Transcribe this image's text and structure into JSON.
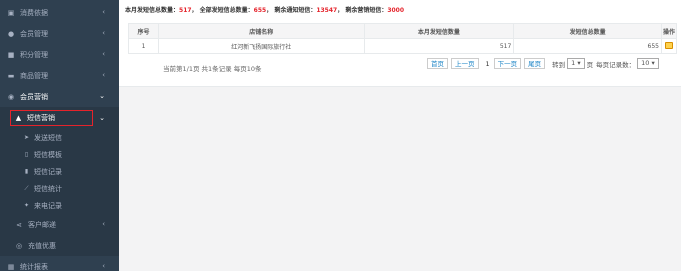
{
  "sidebar": {
    "items": [
      {
        "icon": "list-alt-icon",
        "label": "消费依据",
        "chev": "‹"
      },
      {
        "icon": "user-icon",
        "label": "会员管理",
        "chev": "‹"
      },
      {
        "icon": "gift-icon",
        "label": "积分管理",
        "chev": "‹"
      },
      {
        "icon": "cart-icon",
        "label": "商品管理",
        "chev": "‹"
      },
      {
        "icon": "globe-icon",
        "label": "会员营销",
        "chev": "⌄"
      }
    ],
    "active_sub": {
      "icon": "bullhorn-icon",
      "label": "短信营销",
      "chev": "⌄"
    },
    "subsub": [
      {
        "icon": "send-icon",
        "label": "发送短信"
      },
      {
        "icon": "file-icon",
        "label": "短信模板"
      },
      {
        "icon": "bar-chart-icon",
        "label": "短信记录"
      },
      {
        "icon": "line-chart-icon",
        "label": "短信统计"
      },
      {
        "icon": "twitter-icon",
        "label": "来电记录"
      }
    ],
    "after": [
      {
        "icon": "share-icon",
        "label": "客户邮递",
        "chev": "‹"
      },
      {
        "icon": "eye-icon",
        "label": "充值优惠",
        "chev": ""
      }
    ],
    "bottom": {
      "icon": "chart-icon",
      "label": "统计报表",
      "chev": "‹"
    }
  },
  "stats": {
    "month_label": "本月发短信总数量：",
    "month_value": "517",
    "all_label": "全部发短信总数量：",
    "all_value": "655",
    "notice_label": "剩余通知短信：",
    "notice_value": "13547",
    "marketing_label": "剩余营销短信：",
    "marketing_value": "3000",
    "sep": "，"
  },
  "table": {
    "headers": [
      "序号",
      "店铺名称",
      "本月发短信数量",
      "发短信总数量",
      "操作"
    ],
    "rows": [
      [
        "1",
        "红河新飞扬国际旅行社",
        "517",
        "655"
      ]
    ]
  },
  "pager": {
    "info": "当前第1/1页 共1条记录 每页10条",
    "first": "首页",
    "prev": "上一页",
    "current": "1",
    "next": "下一页",
    "last": "尾页",
    "goto_label": "转到",
    "goto_value": "1 ▾",
    "page_unit": "页",
    "per_page_label": "每页记录数：",
    "per_page_value": "10 ▾"
  }
}
